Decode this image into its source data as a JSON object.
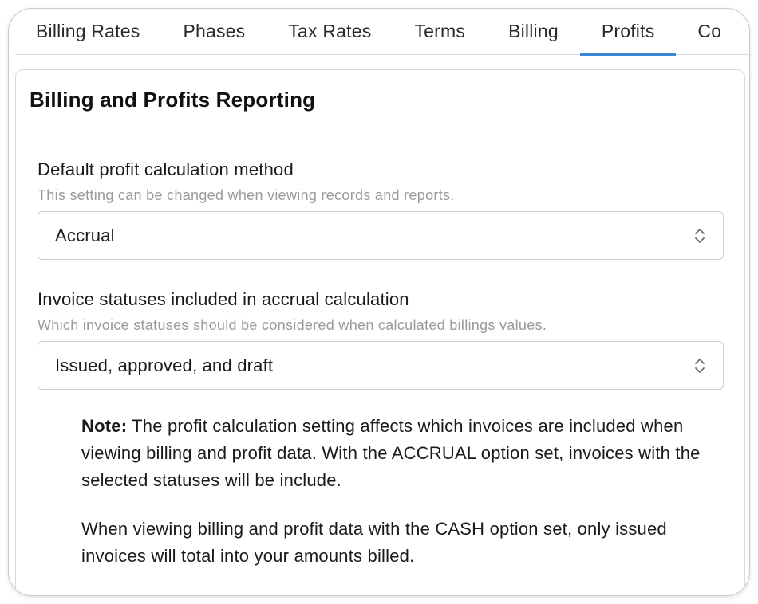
{
  "tabs": [
    {
      "label": "Billing Rates",
      "active": false
    },
    {
      "label": "Phases",
      "active": false
    },
    {
      "label": "Tax Rates",
      "active": false
    },
    {
      "label": "Terms",
      "active": false
    },
    {
      "label": "Billing",
      "active": false
    },
    {
      "label": "Profits",
      "active": true
    },
    {
      "label": "Co",
      "active": false
    }
  ],
  "card": {
    "title": "Billing and Profits Reporting",
    "profit_method": {
      "label": "Default profit calculation method",
      "help": "This setting can be changed when viewing records and reports.",
      "value": "Accrual"
    },
    "invoice_statuses": {
      "label": "Invoice statuses included in accrual calculation",
      "help": "Which invoice statuses should be considered when calculated billings values.",
      "value": "Issued, approved, and draft"
    },
    "note": {
      "prefix": "Note:",
      "text": " The profit calculation setting affects which invoices are included when viewing billing and profit data. With the ACCRUAL option set, invoices with the selected statuses will be include.",
      "paragraph2": "When viewing billing and profit data with the CASH option set, only issued invoices will total into your amounts billed."
    }
  },
  "colors": {
    "accent": "#3a86d4",
    "help_text": "#9a9a9a",
    "border": "#cfcfcf"
  },
  "icons": {
    "select_indicator": "chevron-up-down-icon"
  }
}
